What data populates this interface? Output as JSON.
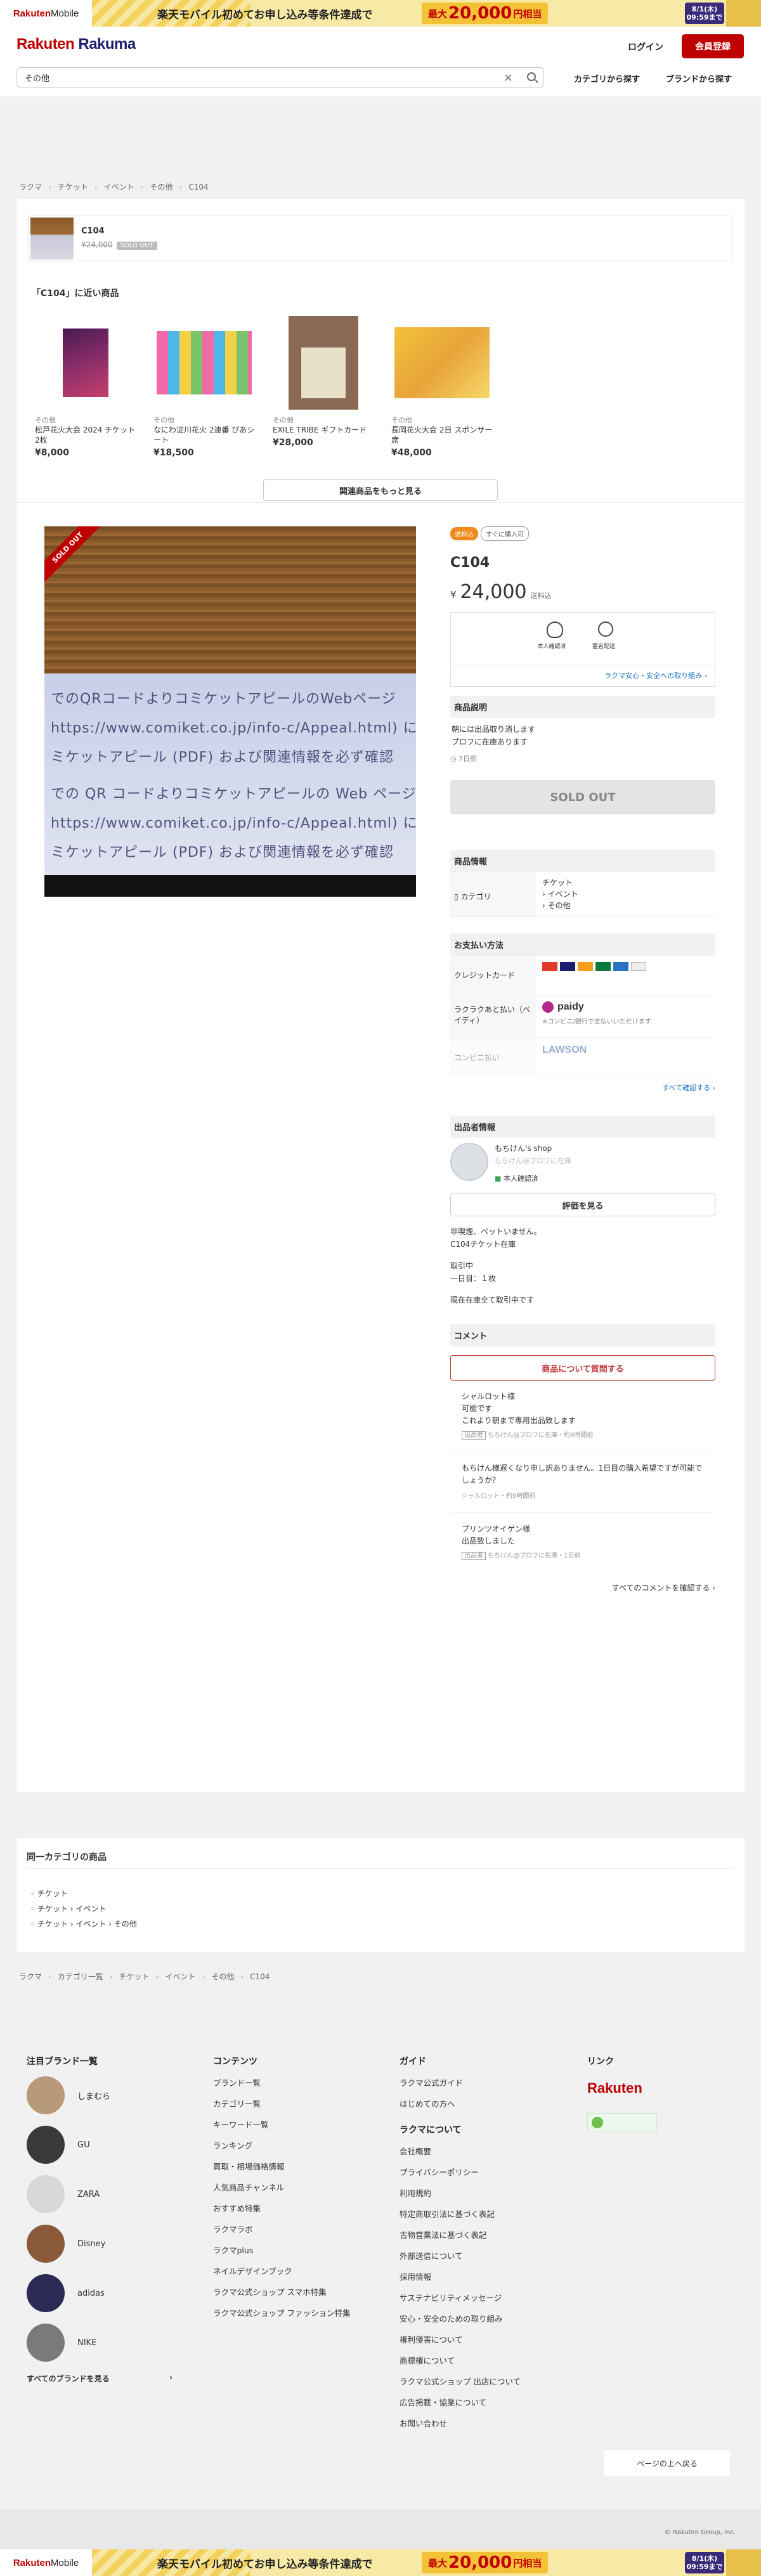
{
  "banner": {
    "logo_a": "Rakuten",
    "logo_b": "Mobile",
    "text": "楽天モバイル初めてお申し込み等条件達成で",
    "amount_pre": "最大",
    "amount": "20,000",
    "amount_post": "円相当",
    "date1": "8/1(木)",
    "date2": "09:59まで"
  },
  "header": {
    "brand_a": "Rakuten",
    "brand_b": " Rakuma",
    "login": "ログイン",
    "signup": "会員登録",
    "search_value": "その他",
    "nav_category": "カテゴリから探す",
    "nav_brand": "ブランドから探す"
  },
  "breadcrumb_top": [
    "ラクマ",
    "チケット",
    "イベント",
    "その他",
    "C104"
  ],
  "summary": {
    "name": "C104",
    "price": "¥24,000",
    "sold": "SOLD OUT"
  },
  "recommend": {
    "title": "「C104」に近い商品",
    "items": [
      {
        "category": "その他",
        "name": "松戸花火大会 2024 チケット 2枚",
        "price": "¥8,000"
      },
      {
        "category": "その他",
        "name": "なにわ淀川花火 2連番 ぴあシート",
        "price": "¥18,500"
      },
      {
        "category": "その他",
        "name": "EXILE TRIBE ギフトカード",
        "price": "¥28,000"
      },
      {
        "category": "その他",
        "name": "長岡花火大会 2日 スポンサー席",
        "price": "¥48,000"
      }
    ],
    "more": "関連商品をもっと見る"
  },
  "image": {
    "ribbon": "SOLD OUT",
    "lines": [
      "でのQRコードよりコミケットアピールのWebページ",
      "https://www.comiket.co.jp/info-c/Appeal.html) にア",
      "ミケットアピール (PDF) および関連情報を必ず確認",
      "での QR コードよりコミケットアピールの Web ページ",
      "https://www.comiket.co.jp/info-c/Appeal.html) にア",
      "ミケットアピール (PDF) および関連情報を必ず確認"
    ]
  },
  "item": {
    "tag_shipping": "送料込",
    "tag_buy": "すぐに購入可",
    "title": "C104",
    "yen": "¥",
    "price": "24,000",
    "price_note": "送料込",
    "badge1": "本人確認済",
    "badge2": "匿名配送",
    "safe_link": "ラクマ安心・安全への取り組み",
    "desc_head": "商品説明",
    "desc1": "朝には出品取り消します",
    "desc2": "プロフに在庫あります",
    "ago": "7日前",
    "soldout": "SOLD OUT"
  },
  "info": {
    "head": "商品情報",
    "cat_label": "カテゴリ",
    "cat1": "チケット",
    "cat2": "› イベント",
    "cat3": "› その他"
  },
  "payment": {
    "head": "お支払い方法",
    "credit": "クレジットカード",
    "paidy_label": "ラクラクあと払い（ペイディ）",
    "paidy": "paidy",
    "paidy_note": "※コンビニ/銀行で支払いいただけます",
    "conv": "コンビニ払い",
    "lawson": "LAWSON",
    "more": "すべて確認する"
  },
  "seller": {
    "head": "出品者情報",
    "name": "もちけん's shop",
    "sub": "もちけん@プロフに在庫",
    "verified": "本人確認済",
    "review": "評価を見る",
    "bio": [
      "非喫煙、ペットいません。",
      "C104チケット在庫",
      "",
      "取引中",
      "一日目：１枚",
      "",
      "現在在庫全て取引中です"
    ]
  },
  "comments": {
    "head": "コメント",
    "ask": "商品について質問する",
    "list": [
      {
        "name": "シャルロット様",
        "lines": [
          "可能です",
          "これより朝まで専用出品致します"
        ],
        "seller_tag": "出品者",
        "meta": "もちけん@プロフに在庫・約8時間前"
      },
      {
        "name": "",
        "lines": [
          "もちけん様遅くなり申し訳ありません。1日目の購入希望ですが可能でしょうか？"
        ],
        "seller_tag": "",
        "meta": "シャルロット・約9時間前"
      },
      {
        "name": "プリンツオイゲン様",
        "lines": [
          "出品致しました"
        ],
        "seller_tag": "出品者",
        "meta": "もちけん@プロフに在庫・1日前"
      }
    ],
    "all": "すべてのコメントを確認する"
  },
  "samecat": {
    "head": "同一カテゴリの商品",
    "items": [
      "チケット",
      "チケット › イベント",
      "チケット › イベント › その他"
    ]
  },
  "breadcrumb_bottom": [
    "ラクマ",
    "カテゴリ一覧",
    "チケット",
    "イベント",
    "その他",
    "C104"
  ],
  "footer": {
    "brands_head": "注目ブランド一覧",
    "brands": [
      "しまむら",
      "GU",
      "ZARA",
      "Disney",
      "adidas",
      "NIKE"
    ],
    "brands_all": "すべてのブランドを見る",
    "contents_head": "コンテンツ",
    "contents": [
      "ブランド一覧",
      "カテゴリ一覧",
      "キーワード一覧",
      "ランキング",
      "買取・相場価格情報",
      "人気商品チャンネル",
      "おすすめ特集",
      "ラクマラボ",
      "ラクマplus",
      "ネイルデザインブック",
      "ラクマ公式ショップ スマホ特集",
      "ラクマ公式ショップ ファッション特集"
    ],
    "guide_head": "ガイド",
    "guide": [
      "ラクマ公式ガイド",
      "はじめての方へ"
    ],
    "about_head": "ラクマについて",
    "about": [
      "会社概要",
      "プライバシーポリシー",
      "利用規約",
      "特定商取引法に基づく表記",
      "古物営業法に基づく表記",
      "外部送信について",
      "採用情報",
      "サステナビリティメッセージ",
      "安心・安全のための取り組み",
      "権利侵害について",
      "商標権について",
      "ラクマ公式ショップ 出店について",
      "広告掲載・協業について",
      "お問い合わせ"
    ],
    "links_head": "リンク",
    "rakuten": "Rakuten",
    "totop": "ページの上へ戻る",
    "copyright": "© Rakuten Group, Inc."
  }
}
